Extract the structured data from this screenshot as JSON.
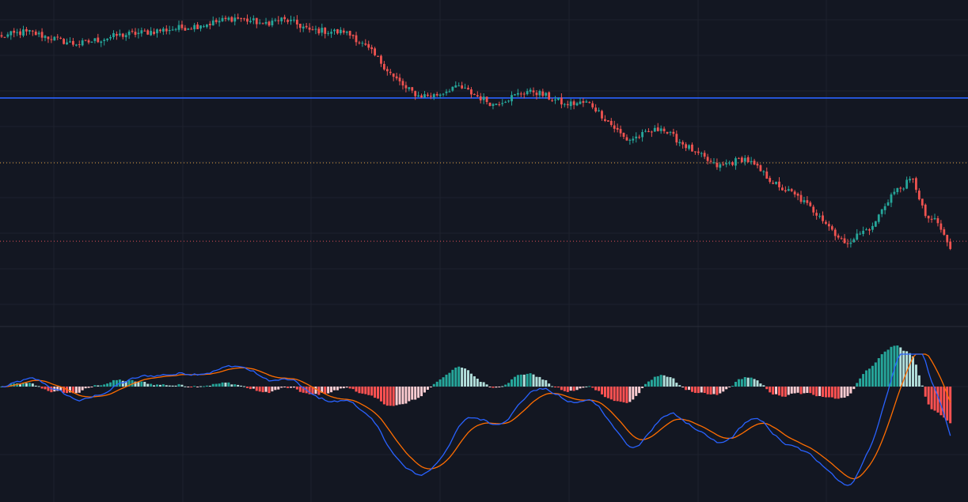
{
  "chart_data": [
    {
      "type": "candlestick",
      "title": "",
      "xlabel": "",
      "ylabel": "",
      "ylim": [
        0,
        100
      ],
      "horizontal_lines": [
        {
          "value": 68.6,
          "style": "solid",
          "color": "#2962ff"
        },
        {
          "value": 46.0,
          "style": "dotted",
          "color": "#e0a040"
        },
        {
          "value": 18.7,
          "style": "dotted",
          "color": "#e0505a"
        }
      ],
      "up_color": "#26a69a",
      "down_color": "#ef5350",
      "waypoints": [
        {
          "i": 0,
          "v": 90.0
        },
        {
          "i": 8,
          "v": 91.8
        },
        {
          "i": 24,
          "v": 87.2
        },
        {
          "i": 37,
          "v": 90.3
        },
        {
          "i": 64,
          "v": 93.9
        },
        {
          "i": 75,
          "v": 96.6
        },
        {
          "i": 84,
          "v": 94.6
        },
        {
          "i": 91,
          "v": 96.1
        },
        {
          "i": 99,
          "v": 92.4
        },
        {
          "i": 110,
          "v": 91.4
        },
        {
          "i": 113,
          "v": 90.2
        },
        {
          "i": 120,
          "v": 83.5
        },
        {
          "i": 126,
          "v": 76.0
        },
        {
          "i": 130,
          "v": 72.0
        },
        {
          "i": 134,
          "v": 69.5
        },
        {
          "i": 140,
          "v": 69.5
        },
        {
          "i": 146,
          "v": 73.0
        },
        {
          "i": 158,
          "v": 66.5
        },
        {
          "i": 170,
          "v": 71.5
        },
        {
          "i": 181,
          "v": 66.5
        },
        {
          "i": 189,
          "v": 67.0
        },
        {
          "i": 201,
          "v": 53.8
        },
        {
          "i": 212,
          "v": 58.0
        },
        {
          "i": 223,
          "v": 49.7
        },
        {
          "i": 230,
          "v": 44.5
        },
        {
          "i": 239,
          "v": 47.7
        },
        {
          "i": 250,
          "v": 37.5
        },
        {
          "i": 255,
          "v": 35.0
        },
        {
          "i": 263,
          "v": 27.5
        },
        {
          "i": 271,
          "v": 18.0
        },
        {
          "i": 280,
          "v": 24.0
        },
        {
          "i": 286,
          "v": 35.0
        },
        {
          "i": 293,
          "v": 40.5
        },
        {
          "i": 297,
          "v": 27.5
        },
        {
          "i": 301,
          "v": 25.0
        },
        {
          "i": 305,
          "v": 16.0
        }
      ],
      "bars": 306
    },
    {
      "type": "macd",
      "series": [
        {
          "role": "macd",
          "color": "#2962ff"
        },
        {
          "role": "signal",
          "color": "#ff6d00"
        },
        {
          "role": "histogram",
          "colors": [
            "#26a69a",
            "#b2dfdb",
            "#ff5252",
            "#ffcdd2"
          ]
        }
      ],
      "zero_line": 0
    }
  ]
}
